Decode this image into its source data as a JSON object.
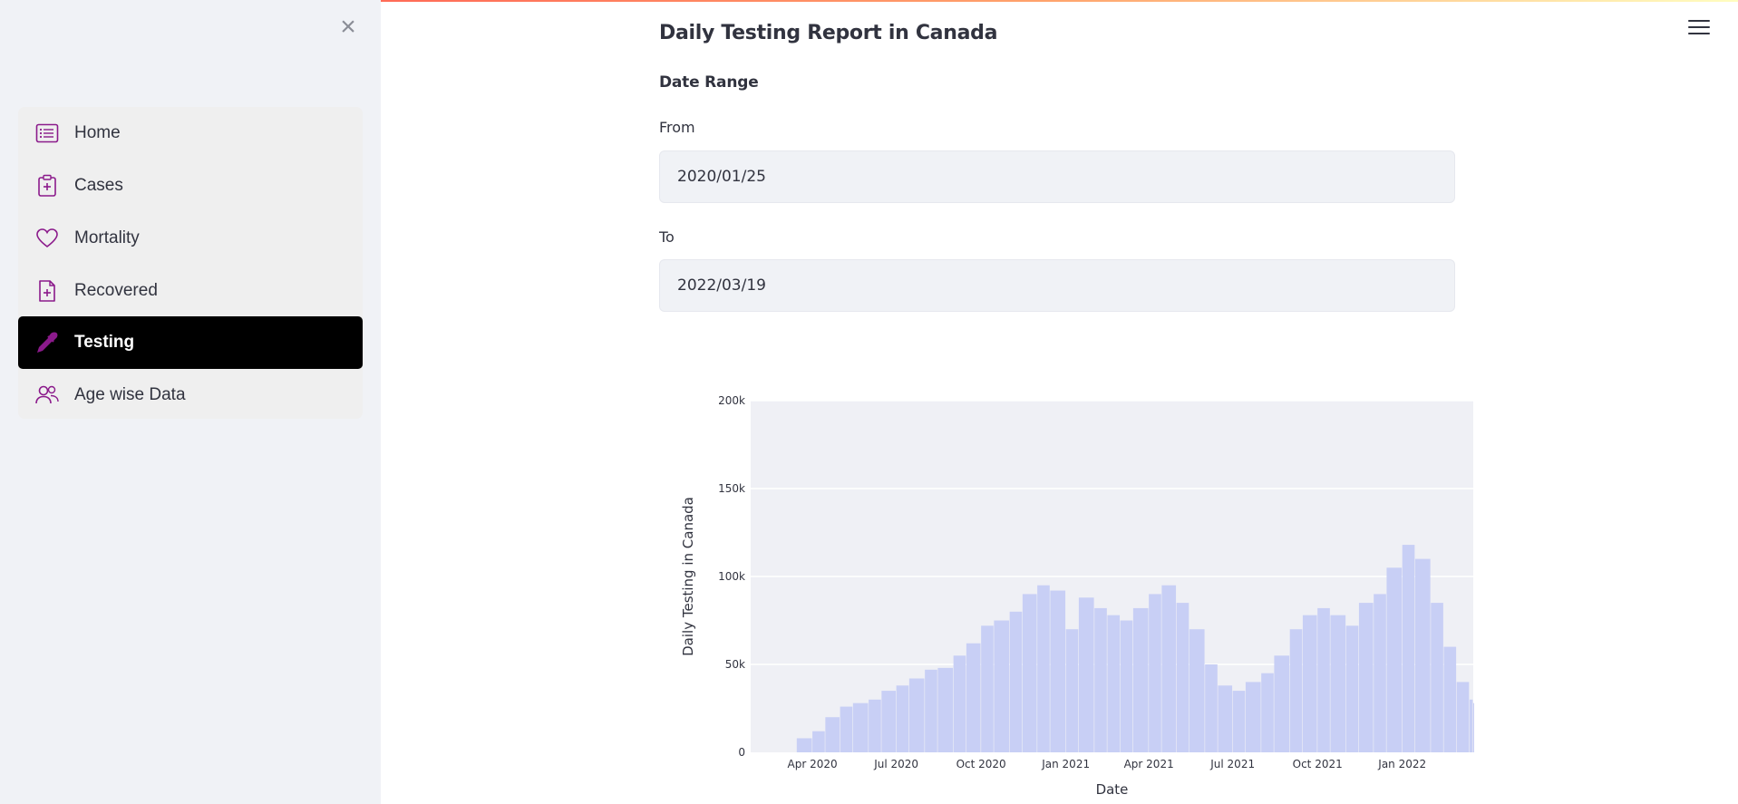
{
  "sidebar": {
    "close_icon": "close-icon",
    "items": [
      {
        "label": "Home",
        "icon": "list-icon",
        "active": false
      },
      {
        "label": "Cases",
        "icon": "clipboard-plus-icon",
        "active": false
      },
      {
        "label": "Mortality",
        "icon": "heart-icon",
        "active": false
      },
      {
        "label": "Recovered",
        "icon": "file-plus-icon",
        "active": false
      },
      {
        "label": "Testing",
        "icon": "eyedropper-icon",
        "active": true
      },
      {
        "label": "Age wise Data",
        "icon": "people-icon",
        "active": false
      }
    ],
    "icon_color": "#8b1a8b"
  },
  "header": {
    "menu_icon": "hamburger-icon"
  },
  "main": {
    "title": "Daily Testing Report in Canada",
    "date_range_label": "Date Range",
    "from_label": "From",
    "from_value": "2020/01/25",
    "to_label": "To",
    "to_value": "2022/03/19"
  },
  "chart_data": {
    "type": "bar",
    "xlabel": "Date",
    "ylabel": "Daily Testing in Canada",
    "ylim": [
      0,
      200000
    ],
    "yticks": [
      {
        "value": 0,
        "label": "0"
      },
      {
        "value": 50000,
        "label": "50k"
      },
      {
        "value": 100000,
        "label": "100k"
      },
      {
        "value": 150000,
        "label": "150k"
      },
      {
        "value": 200000,
        "label": "200k"
      }
    ],
    "x_range": [
      "2020-01-25",
      "2022-03-19"
    ],
    "xticks": [
      {
        "date": "2020-04-01",
        "label": "Apr 2020"
      },
      {
        "date": "2020-07-01",
        "label": "Jul 2020"
      },
      {
        "date": "2020-10-01",
        "label": "Oct 2020"
      },
      {
        "date": "2021-01-01",
        "label": "Jan 2021"
      },
      {
        "date": "2021-04-01",
        "label": "Apr 2021"
      },
      {
        "date": "2021-07-01",
        "label": "Jul 2021"
      },
      {
        "date": "2021-10-01",
        "label": "Oct 2021"
      },
      {
        "date": "2022-01-01",
        "label": "Jan 2022"
      }
    ],
    "bar_color": "#c8cff5",
    "plot_bg": "#eff0f5",
    "grid": true,
    "series": [
      {
        "x": [
          "2020-03-15",
          "2020-04-01",
          "2020-04-15",
          "2020-05-01",
          "2020-05-15",
          "2020-06-01",
          "2020-06-15",
          "2020-07-01",
          "2020-07-15",
          "2020-08-01",
          "2020-08-15",
          "2020-09-01",
          "2020-09-15",
          "2020-10-01",
          "2020-10-15",
          "2020-11-01",
          "2020-11-15",
          "2020-12-01",
          "2020-12-15",
          "2021-01-01",
          "2021-01-15",
          "2021-02-01",
          "2021-02-15",
          "2021-03-01",
          "2021-03-15",
          "2021-04-01",
          "2021-04-15",
          "2021-05-01",
          "2021-05-15",
          "2021-06-01",
          "2021-06-15",
          "2021-07-01",
          "2021-07-15",
          "2021-08-01",
          "2021-08-15",
          "2021-09-01",
          "2021-09-15",
          "2021-10-01",
          "2021-10-15",
          "2021-11-01",
          "2021-11-15",
          "2021-12-01",
          "2021-12-15",
          "2022-01-01",
          "2022-01-15",
          "2022-02-01",
          "2022-02-15",
          "2022-03-01",
          "2022-03-15",
          "2022-03-19"
        ],
        "values": [
          8000,
          12000,
          20000,
          26000,
          28000,
          30000,
          35000,
          38000,
          42000,
          47000,
          48000,
          55000,
          62000,
          72000,
          75000,
          80000,
          90000,
          95000,
          92000,
          70000,
          88000,
          82000,
          78000,
          75000,
          82000,
          90000,
          95000,
          85000,
          70000,
          50000,
          38000,
          35000,
          40000,
          45000,
          55000,
          70000,
          78000,
          82000,
          78000,
          72000,
          85000,
          90000,
          105000,
          118000,
          110000,
          85000,
          60000,
          40000,
          30000,
          28000
        ]
      }
    ]
  }
}
